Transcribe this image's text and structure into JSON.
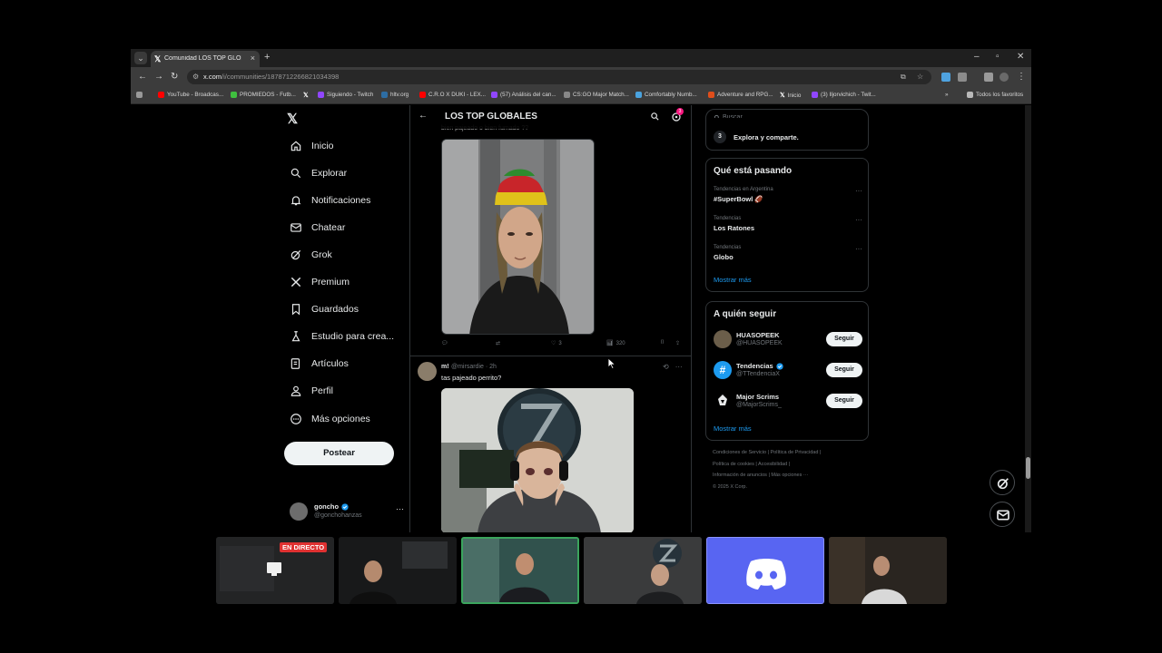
{
  "browser": {
    "tab_title": "Comunidad LOS TOP GLOBALES",
    "url_host": "x.com",
    "url_path": "/i/communities/1878712266821034398",
    "bookmarks": [
      {
        "label": "YouTube - Broadcas...",
        "color": "#ff0000"
      },
      {
        "label": "PROMIEDOS - Futb...",
        "color": "#3fbf3f"
      },
      {
        "label": "",
        "color": "#000000"
      },
      {
        "label": "Siguiendo - Twitch",
        "color": "#9146ff"
      },
      {
        "label": "hltv.org",
        "color": "#2d6da3"
      },
      {
        "label": "C.R.O X DUKI - LEX...",
        "color": "#ff0000"
      },
      {
        "label": "(57) Análisis del can...",
        "color": "#9146ff"
      },
      {
        "label": "CS:GO Major Match...",
        "color": "#888888"
      },
      {
        "label": "Comfortably Numb...",
        "color": "#4aa3df"
      },
      {
        "label": "Adventure and RPG...",
        "color": "#e04e1b"
      },
      {
        "label": "Inicio",
        "color": "#000000"
      },
      {
        "label": "(3) Iljorvichich - Twit...",
        "color": "#9146ff"
      }
    ],
    "bookmarks_folder": "Todos los favoritos"
  },
  "nav": {
    "items": [
      {
        "label": "Inicio",
        "icon": "home-icon"
      },
      {
        "label": "Explorar",
        "icon": "search-icon"
      },
      {
        "label": "Notificaciones",
        "icon": "bell-icon"
      },
      {
        "label": "Chatear",
        "icon": "mail-icon"
      },
      {
        "label": "Grok",
        "icon": "grok-icon"
      },
      {
        "label": "Premium",
        "icon": "x-premium-icon"
      },
      {
        "label": "Guardados",
        "icon": "bookmark-icon"
      },
      {
        "label": "Estudio para crea...",
        "icon": "studio-icon"
      },
      {
        "label": "Artículos",
        "icon": "article-icon"
      },
      {
        "label": "Perfil",
        "icon": "person-icon"
      },
      {
        "label": "Más opciones",
        "icon": "more-circle-icon"
      }
    ],
    "post_label": "Postear",
    "profile": {
      "name": "goncho",
      "handle": "@gonchohanzas"
    }
  },
  "community": {
    "title": "LOS TOP GLOBALES",
    "notif_badge": "3",
    "cutoff_text": "bien pajeado o bien fumado ??",
    "tweet1_actions": {
      "likes": "3",
      "views": "320"
    },
    "tweet2": {
      "name": "m!",
      "meta": "@mirsardie · 2h",
      "text": "tas pajeado perrito?"
    }
  },
  "right": {
    "search_placeholder": "Buscar",
    "step": {
      "num": "3",
      "text": "Explora y comparte."
    },
    "trends_title": "Qué está pasando",
    "trends": [
      {
        "context": "Tendencias en Argentina",
        "name": "#SuperBowl 🏈"
      },
      {
        "context": "Tendencias",
        "name": "Los Ratones"
      },
      {
        "context": "Tendencias",
        "name": "Globo"
      }
    ],
    "show_more": "Mostrar más",
    "follow_title": "A quién seguir",
    "follow": [
      {
        "name": "HUASOPEEK",
        "handle": "@HUASOPEEK",
        "verified": false,
        "button": "Seguir"
      },
      {
        "name": "Tendencias",
        "handle": "@TTendenciaX",
        "verified": true,
        "button": "Seguir"
      },
      {
        "name": "Major Scrims",
        "handle": "@MajorScrims_",
        "verified": false,
        "button": "Seguir"
      }
    ],
    "footer_lines": [
      "Condiciones de Servicio  |  Política de Privacidad  |",
      "Política de cookies  |  Accesibilidad  |",
      "Información de anuncios  |  Más opciones ···",
      "© 2025 X Corp."
    ]
  },
  "stream": {
    "live_label": "EN DIRECTO",
    "discord_color": "#5865f2"
  }
}
